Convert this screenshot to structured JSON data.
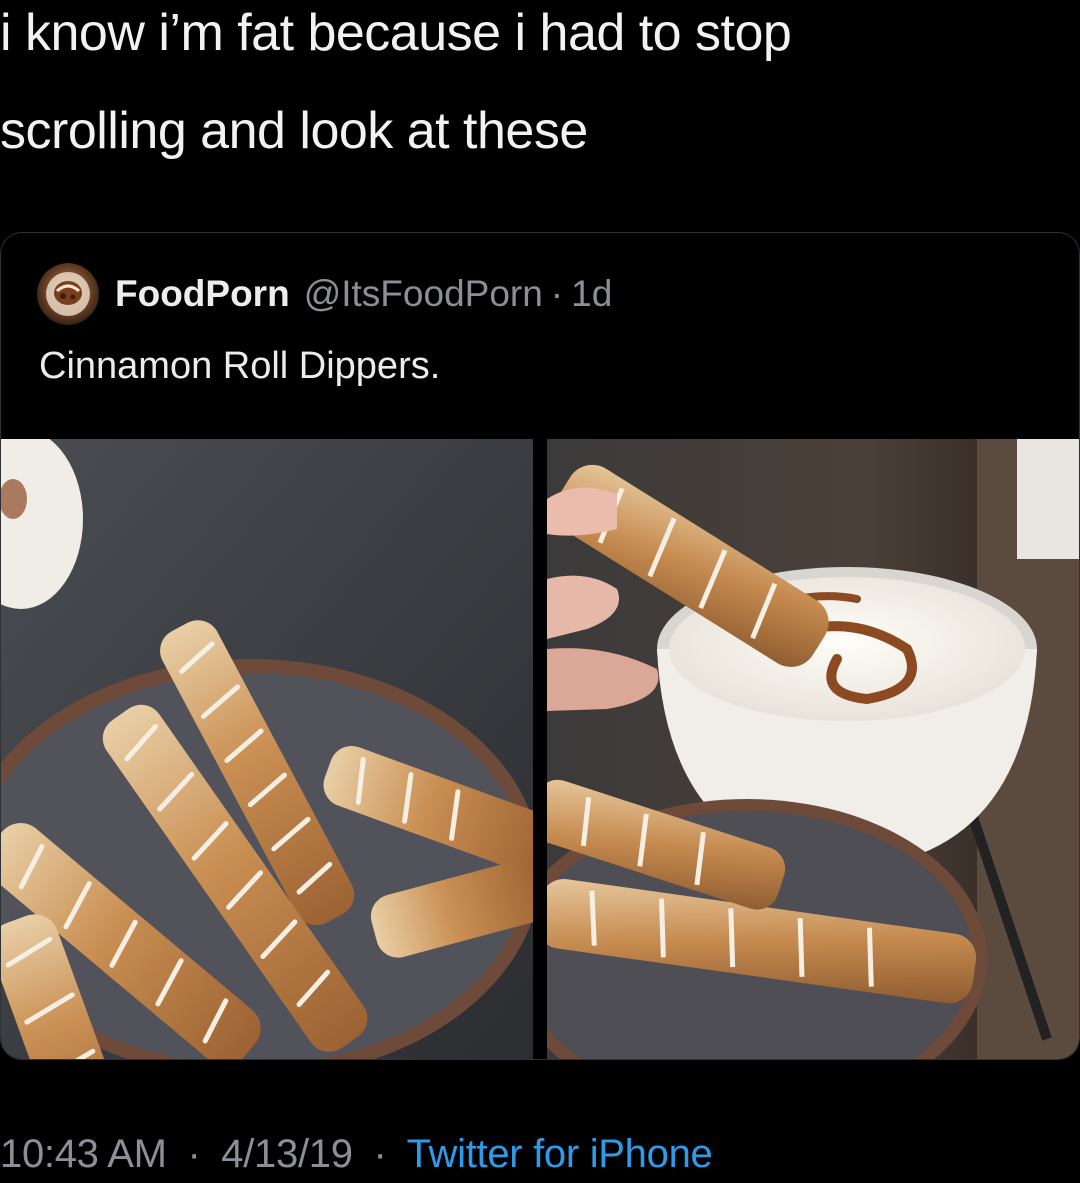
{
  "tweet": {
    "text_line1": "i know i’m fat because i had to stop",
    "text_line2": "scrolling and look at these"
  },
  "quoted_tweet": {
    "display_name": "FoodPorn",
    "handle": "@ItsFoodPorn",
    "separator": "·",
    "age": "1d",
    "text": "Cinnamon Roll Dippers.",
    "avatar_icon": "food-avatar-icon",
    "media": [
      {
        "name": "cinnamon-sticks-plate-photo"
      },
      {
        "name": "cinnamon-stick-dipping-photo"
      }
    ]
  },
  "footer": {
    "time": "10:43 AM",
    "sep1": "·",
    "date": "4/13/19",
    "sep2": "·",
    "source": "Twitter for iPhone"
  },
  "colors": {
    "background": "#000000",
    "text": "#ececec",
    "muted": "#8b9096",
    "link": "#2f9be8",
    "border": "#2f3336"
  }
}
